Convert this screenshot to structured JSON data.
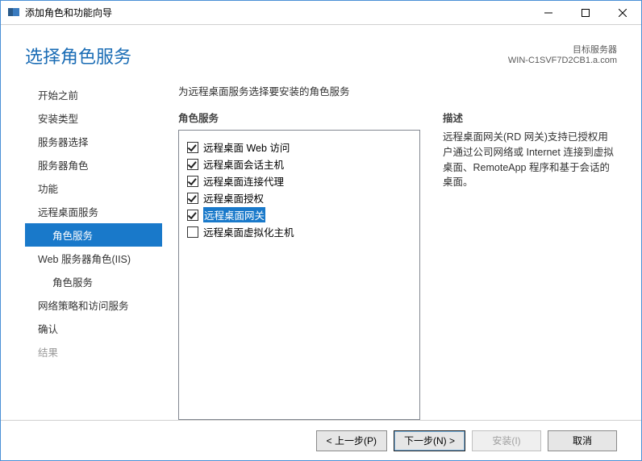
{
  "window": {
    "title": "添加角色和功能向导"
  },
  "header": {
    "title": "选择角色服务",
    "server_label": "目标服务器",
    "server_name": "WIN-C1SVF7D2CB1.a.com"
  },
  "sidebar": {
    "items": [
      {
        "label": "开始之前",
        "selected": false,
        "indent": false,
        "disabled": false
      },
      {
        "label": "安装类型",
        "selected": false,
        "indent": false,
        "disabled": false
      },
      {
        "label": "服务器选择",
        "selected": false,
        "indent": false,
        "disabled": false
      },
      {
        "label": "服务器角色",
        "selected": false,
        "indent": false,
        "disabled": false
      },
      {
        "label": "功能",
        "selected": false,
        "indent": false,
        "disabled": false
      },
      {
        "label": "远程桌面服务",
        "selected": false,
        "indent": false,
        "disabled": false
      },
      {
        "label": "角色服务",
        "selected": true,
        "indent": true,
        "disabled": false
      },
      {
        "label": "Web 服务器角色(IIS)",
        "selected": false,
        "indent": false,
        "disabled": false
      },
      {
        "label": "角色服务",
        "selected": false,
        "indent": true,
        "disabled": false
      },
      {
        "label": "网络策略和访问服务",
        "selected": false,
        "indent": false,
        "disabled": false
      },
      {
        "label": "确认",
        "selected": false,
        "indent": false,
        "disabled": false
      },
      {
        "label": "结果",
        "selected": false,
        "indent": false,
        "disabled": true
      }
    ]
  },
  "content": {
    "prompt": "为远程桌面服务选择要安装的角色服务",
    "services_label": "角色服务",
    "desc_label": "描述",
    "desc_text": "远程桌面网关(RD 网关)支持已授权用户通过公司网络或 Internet 连接到虚拟桌面、RemoteApp 程序和基于会话的桌面。",
    "services": [
      {
        "label": "远程桌面 Web 访问",
        "checked": true,
        "highlight": false
      },
      {
        "label": "远程桌面会话主机",
        "checked": true,
        "highlight": false
      },
      {
        "label": "远程桌面连接代理",
        "checked": true,
        "highlight": false
      },
      {
        "label": "远程桌面授权",
        "checked": true,
        "highlight": false
      },
      {
        "label": "远程桌面网关",
        "checked": true,
        "highlight": true
      },
      {
        "label": "远程桌面虚拟化主机",
        "checked": false,
        "highlight": false
      }
    ]
  },
  "footer": {
    "prev": "< 上一步(P)",
    "next": "下一步(N) >",
    "install": "安装(I)",
    "cancel": "取消"
  }
}
